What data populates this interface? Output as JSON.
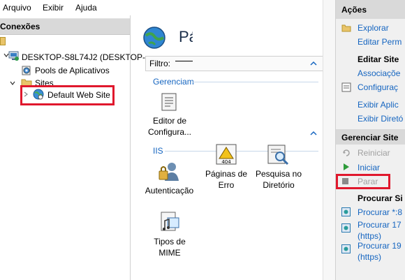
{
  "menu": {
    "file": "Arquivo",
    "view": "Exibir",
    "help": "Ajuda"
  },
  "connections": {
    "title": "Conexões",
    "server": "DESKTOP-S8L74J2 (DESKTOP-",
    "app_pools": "Pools de Aplicativos",
    "sites": "Sites",
    "default_site": "Default Web Site"
  },
  "center": {
    "title": "Pá",
    "filter_label": "Filtro:",
    "group_manage": "Gerenciam",
    "group_iis": "IIS",
    "features": {
      "config_editor": [
        "Editor de",
        "Configura..."
      ],
      "auth": "Autenticação",
      "mime": [
        "Tipos de",
        "MIME"
      ],
      "error_pages": [
        "Páginas de",
        "Erro"
      ],
      "dir_browse": [
        "Pesquisa no",
        "Diretório"
      ],
      "error_badge": "404"
    }
  },
  "actions": {
    "title": "Ações",
    "explore": "Explorar",
    "edit_perms": "Editar Perm",
    "edit_site_head": "Editar Site",
    "bindings": "Associaçõe",
    "basic_settings": "Configuraç",
    "view_apps": "Exibir Aplic",
    "view_dirs": "Exibir Diretó",
    "manage_site_head": "Gerenciar Site",
    "restart": "Reiniciar",
    "start": "Iniciar",
    "stop": "Parar",
    "browse_head": "Procurar Si",
    "browse_1": "Procurar *:8",
    "browse_2": "Procurar 17",
    "browse_2b": "(https)",
    "browse_3": "Procurar 19",
    "browse_3b": "(https)"
  },
  "colors": {
    "accent": "#1565c0",
    "highlight_box": "#e0182d",
    "header_bg": "#d9d9d9"
  }
}
